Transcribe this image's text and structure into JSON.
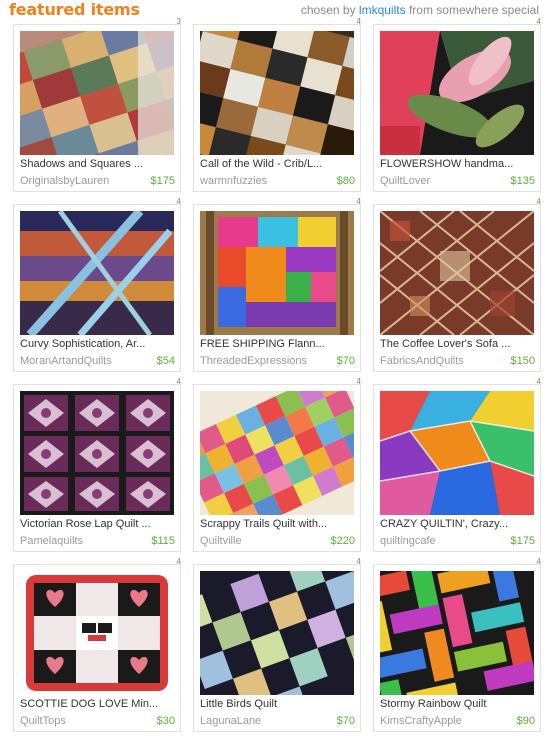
{
  "header": {
    "title": "featured items",
    "chosen_by": "chosen by",
    "curator": "lmkquilts",
    "from": "from",
    "location": "somewhere special"
  },
  "items": [
    {
      "title": "Shadows and Squares ...",
      "shop": "OriginalsbyLauren",
      "price": "$175",
      "corner": "3"
    },
    {
      "title": "Call of the Wild - Crib/L...",
      "shop": "warmnfuzzies",
      "price": "$80",
      "corner": "4"
    },
    {
      "title": "FLOWERSHOW handma...",
      "shop": "QuiltLover",
      "price": "$135",
      "corner": "4"
    },
    {
      "title": "Curvy Sophistication, Ar...",
      "shop": "MoranArtandQuilts",
      "price": "$54",
      "corner": "4"
    },
    {
      "title": "FREE SHIPPING Flann...",
      "shop": "ThreadedExpressions",
      "price": "$70",
      "corner": "4"
    },
    {
      "title": "The Coffee Lover's Sofa ...",
      "shop": "FabricsAndQuilts",
      "price": "$150",
      "corner": "4"
    },
    {
      "title": "Victorian Rose Lap Quilt ...",
      "shop": "Pamelaquilts",
      "price": "$115",
      "corner": "4"
    },
    {
      "title": "Scrappy Trails Quilt with...",
      "shop": "Quiltville",
      "price": "$220",
      "corner": "4"
    },
    {
      "title": "CRAZY QUILTIN', Crazy...",
      "shop": "quiltingcafe",
      "price": "$175",
      "corner": "4"
    },
    {
      "title": "SCOTTIE DOG LOVE Min...",
      "shop": "QuiltTops",
      "price": "$30",
      "corner": "4"
    },
    {
      "title": "Little Birds Quilt",
      "shop": "LagunaLane",
      "price": "$70",
      "corner": "4"
    },
    {
      "title": "Stormy Rainbow Quilt",
      "shop": "KimsCraftyApple",
      "price": "$90",
      "corner": "4"
    }
  ]
}
